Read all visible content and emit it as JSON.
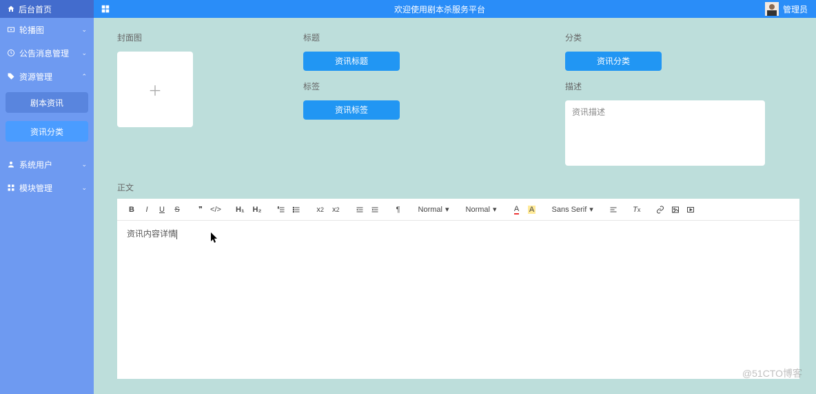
{
  "header": {
    "home_label": "后台首页",
    "title": "欢迎使用剧本杀服务平台",
    "user_role": "管理员"
  },
  "sidebar": {
    "items": [
      {
        "icon": "carousel-icon",
        "label": "轮播图",
        "expandable": true
      },
      {
        "icon": "clock-icon",
        "label": "公告消息管理",
        "expandable": true
      },
      {
        "icon": "tag-icon",
        "label": "资源管理",
        "expandable": true,
        "expanded": true
      }
    ],
    "sub_items": [
      {
        "label": "剧本资讯",
        "active": false
      },
      {
        "label": "资讯分类",
        "active": true
      }
    ],
    "items2": [
      {
        "icon": "user-icon",
        "label": "系统用户",
        "expandable": true
      },
      {
        "icon": "module-icon",
        "label": "模块管理",
        "expandable": true
      }
    ]
  },
  "form": {
    "cover_label": "封面图",
    "title_label": "标题",
    "title_placeholder": "资讯标题",
    "tag_label": "标签",
    "tag_placeholder": "资讯标签",
    "category_label": "分类",
    "category_placeholder": "资讯分类",
    "desc_label": "描述",
    "desc_placeholder": "资讯描述",
    "body_label": "正文"
  },
  "editor": {
    "size_label": "Normal",
    "header_label": "Normal",
    "font_label": "Sans Serif",
    "content": "资讯内容详情"
  },
  "watermark": "@51CTO博客"
}
